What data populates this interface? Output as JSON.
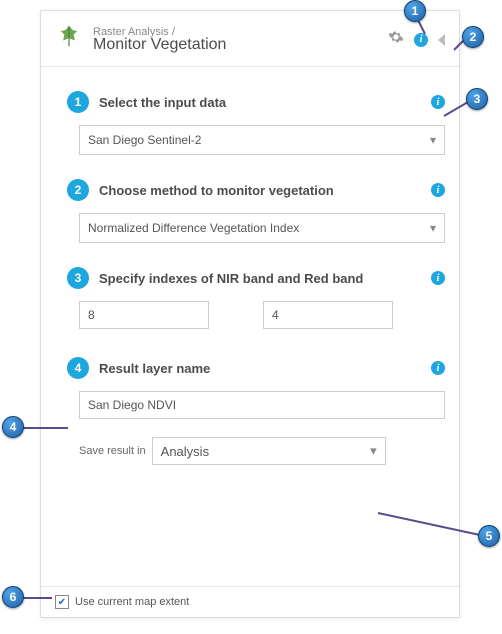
{
  "header": {
    "breadcrumb": "Raster Analysis /",
    "title": "Monitor Vegetation"
  },
  "steps": {
    "s1": {
      "num": "1",
      "label": "Select the input data",
      "value": "San Diego Sentinel-2"
    },
    "s2": {
      "num": "2",
      "label": "Choose method to monitor vegetation",
      "value": "Normalized Difference Vegetation Index"
    },
    "s3": {
      "num": "3",
      "label": "Specify indexes of NIR band and Red band",
      "nir": "8",
      "red": "4"
    },
    "s4": {
      "num": "4",
      "label": "Result layer name",
      "value": "San Diego NDVI",
      "save_label": "Save result in",
      "save_value": "Analysis"
    }
  },
  "footer": {
    "extent_label": "Use current map extent",
    "checked": true
  },
  "callouts": {
    "c1": "1",
    "c2": "2",
    "c3": "3",
    "c4": "4",
    "c5": "5",
    "c6": "6"
  }
}
